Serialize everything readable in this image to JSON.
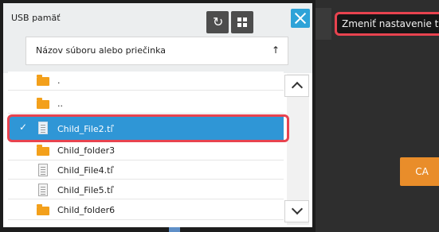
{
  "dialog": {
    "title": "USB pamäť",
    "sort_field_label": "Názov súboru alebo priečinka",
    "sort_arrow": "↑",
    "refresh_glyph": "↻"
  },
  "list": {
    "rows": [
      {
        "type": "folder",
        "name": ".",
        "selected": false
      },
      {
        "type": "folder",
        "name": "..",
        "selected": false
      },
      {
        "type": "file",
        "name": "Child_File2.tiⷡ",
        "selected": true,
        "check": "✓"
      },
      {
        "type": "folder",
        "name": "Child_folder3",
        "selected": false
      },
      {
        "type": "file",
        "name": "Child_File4.tiⷡ",
        "selected": false
      },
      {
        "type": "file",
        "name": "Child_File5.tiⷡ",
        "selected": false
      },
      {
        "type": "folder",
        "name": "Child_folder6",
        "selected": false
      }
    ]
  },
  "right_panel": {
    "settings_button": "Zmeniť nastavenie tlače",
    "ca_button": "CA"
  },
  "colors": {
    "accent_blue": "#2f96d6",
    "highlight_red": "#e8434f",
    "folder_orange": "#f3a01b",
    "ca_orange": "#e98d2a"
  }
}
